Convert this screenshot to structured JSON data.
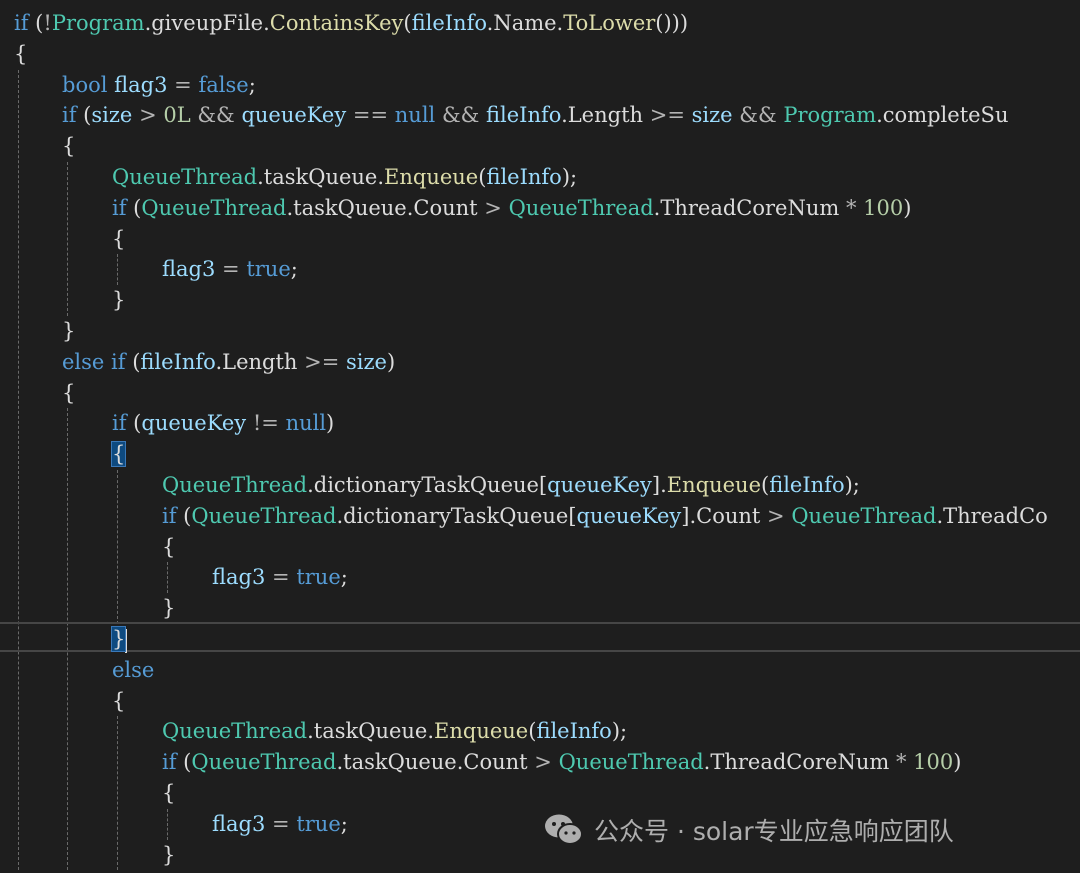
{
  "colors": {
    "background": "#1e1e1e",
    "keyword": "#569cd6",
    "type": "#4ec9b0",
    "method": "#dcdcaa",
    "variable": "#9cdcfe",
    "number": "#b5cea8",
    "operator": "#b4b4b4",
    "plain": "#dcdcdc",
    "brace_highlight": "#0e4a80"
  },
  "code_lines": [
    [
      [
        "kw",
        "if"
      ],
      [
        "plain",
        " ("
      ],
      [
        "op",
        "!"
      ],
      [
        "type",
        "Program"
      ],
      [
        "plain",
        ".giveupFile."
      ],
      [
        "fn",
        "ContainsKey"
      ],
      [
        "plain",
        "("
      ],
      [
        "var",
        "fileInfo"
      ],
      [
        "plain",
        ".Name."
      ],
      [
        "fn",
        "ToLower"
      ],
      [
        "plain",
        "()))"
      ]
    ],
    [
      [
        "plain",
        "{"
      ]
    ],
    [
      [
        "kw",
        "bool"
      ],
      [
        "plain",
        " "
      ],
      [
        "var",
        "flag3"
      ],
      [
        "plain",
        " "
      ],
      [
        "op",
        "="
      ],
      [
        "plain",
        " "
      ],
      [
        "kw",
        "false"
      ],
      [
        "plain",
        ";"
      ]
    ],
    [
      [
        "kw",
        "if"
      ],
      [
        "plain",
        " ("
      ],
      [
        "var",
        "size"
      ],
      [
        "plain",
        " "
      ],
      [
        "op",
        ">"
      ],
      [
        "plain",
        " "
      ],
      [
        "num",
        "0L"
      ],
      [
        "plain",
        " "
      ],
      [
        "op",
        "&&"
      ],
      [
        "plain",
        " "
      ],
      [
        "var",
        "queueKey"
      ],
      [
        "plain",
        " "
      ],
      [
        "op",
        "=="
      ],
      [
        "plain",
        " "
      ],
      [
        "kw",
        "null"
      ],
      [
        "plain",
        " "
      ],
      [
        "op",
        "&&"
      ],
      [
        "plain",
        " "
      ],
      [
        "var",
        "fileInfo"
      ],
      [
        "plain",
        ".Length "
      ],
      [
        "op",
        ">="
      ],
      [
        "plain",
        " "
      ],
      [
        "var",
        "size"
      ],
      [
        "plain",
        " "
      ],
      [
        "op",
        "&&"
      ],
      [
        "plain",
        " "
      ],
      [
        "type",
        "Program"
      ],
      [
        "plain",
        ".completeSu"
      ]
    ],
    [
      [
        "plain",
        "{"
      ]
    ],
    [
      [
        "type",
        "QueueThread"
      ],
      [
        "plain",
        ".taskQueue."
      ],
      [
        "fn",
        "Enqueue"
      ],
      [
        "plain",
        "("
      ],
      [
        "var",
        "fileInfo"
      ],
      [
        "plain",
        ");"
      ]
    ],
    [
      [
        "kw",
        "if"
      ],
      [
        "plain",
        " ("
      ],
      [
        "type",
        "QueueThread"
      ],
      [
        "plain",
        ".taskQueue.Count "
      ],
      [
        "op",
        ">"
      ],
      [
        "plain",
        " "
      ],
      [
        "type",
        "QueueThread"
      ],
      [
        "plain",
        ".ThreadCoreNum "
      ],
      [
        "op",
        "*"
      ],
      [
        "plain",
        " "
      ],
      [
        "num",
        "100"
      ],
      [
        "plain",
        ")"
      ]
    ],
    [
      [
        "plain",
        "{"
      ]
    ],
    [
      [
        "var",
        "flag3"
      ],
      [
        "plain",
        " "
      ],
      [
        "op",
        "="
      ],
      [
        "plain",
        " "
      ],
      [
        "kw",
        "true"
      ],
      [
        "plain",
        ";"
      ]
    ],
    [
      [
        "plain",
        "}"
      ]
    ],
    [
      [
        "plain",
        "}"
      ]
    ],
    [
      [
        "kw",
        "else"
      ],
      [
        "plain",
        " "
      ],
      [
        "kw",
        "if"
      ],
      [
        "plain",
        " ("
      ],
      [
        "var",
        "fileInfo"
      ],
      [
        "plain",
        ".Length "
      ],
      [
        "op",
        ">="
      ],
      [
        "plain",
        " "
      ],
      [
        "var",
        "size"
      ],
      [
        "plain",
        ")"
      ]
    ],
    [
      [
        "plain",
        "{"
      ]
    ],
    [
      [
        "kw",
        "if"
      ],
      [
        "plain",
        " ("
      ],
      [
        "var",
        "queueKey"
      ],
      [
        "plain",
        " "
      ],
      [
        "op",
        "!="
      ],
      [
        "plain",
        " "
      ],
      [
        "kw",
        "null"
      ],
      [
        "plain",
        ")"
      ]
    ],
    [
      [
        "hl",
        "{"
      ]
    ],
    [
      [
        "type",
        "QueueThread"
      ],
      [
        "plain",
        ".dictionaryTaskQueue["
      ],
      [
        "var",
        "queueKey"
      ],
      [
        "plain",
        "]."
      ],
      [
        "fn",
        "Enqueue"
      ],
      [
        "plain",
        "("
      ],
      [
        "var",
        "fileInfo"
      ],
      [
        "plain",
        ");"
      ]
    ],
    [
      [
        "kw",
        "if"
      ],
      [
        "plain",
        " ("
      ],
      [
        "type",
        "QueueThread"
      ],
      [
        "plain",
        ".dictionaryTaskQueue["
      ],
      [
        "var",
        "queueKey"
      ],
      [
        "plain",
        "].Count "
      ],
      [
        "op",
        ">"
      ],
      [
        "plain",
        " "
      ],
      [
        "type",
        "QueueThread"
      ],
      [
        "plain",
        ".ThreadCo"
      ]
    ],
    [
      [
        "plain",
        "{"
      ]
    ],
    [
      [
        "var",
        "flag3"
      ],
      [
        "plain",
        " "
      ],
      [
        "op",
        "="
      ],
      [
        "plain",
        " "
      ],
      [
        "kw",
        "true"
      ],
      [
        "plain",
        ";"
      ]
    ],
    [
      [
        "plain",
        "}"
      ]
    ],
    [
      [
        "hl",
        "}"
      ]
    ],
    [
      [
        "kw",
        "else"
      ]
    ],
    [
      [
        "plain",
        "{"
      ]
    ],
    [
      [
        "type",
        "QueueThread"
      ],
      [
        "plain",
        ".taskQueue."
      ],
      [
        "fn",
        "Enqueue"
      ],
      [
        "plain",
        "("
      ],
      [
        "var",
        "fileInfo"
      ],
      [
        "plain",
        ");"
      ]
    ],
    [
      [
        "kw",
        "if"
      ],
      [
        "plain",
        " ("
      ],
      [
        "type",
        "QueueThread"
      ],
      [
        "plain",
        ".taskQueue.Count "
      ],
      [
        "op",
        ">"
      ],
      [
        "plain",
        " "
      ],
      [
        "type",
        "QueueThread"
      ],
      [
        "plain",
        ".ThreadCoreNum "
      ],
      [
        "op",
        "*"
      ],
      [
        "plain",
        " "
      ],
      [
        "num",
        "100"
      ],
      [
        "plain",
        ")"
      ]
    ],
    [
      [
        "plain",
        "{"
      ]
    ],
    [
      [
        "var",
        "flag3"
      ],
      [
        "plain",
        " "
      ],
      [
        "op",
        "="
      ],
      [
        "plain",
        " "
      ],
      [
        "kw",
        "true"
      ],
      [
        "plain",
        ";"
      ]
    ],
    [
      [
        "plain",
        "}"
      ]
    ]
  ],
  "watermark": {
    "icon": "wechat-icon",
    "text": "公众号 · solar专业应急响应团队"
  }
}
